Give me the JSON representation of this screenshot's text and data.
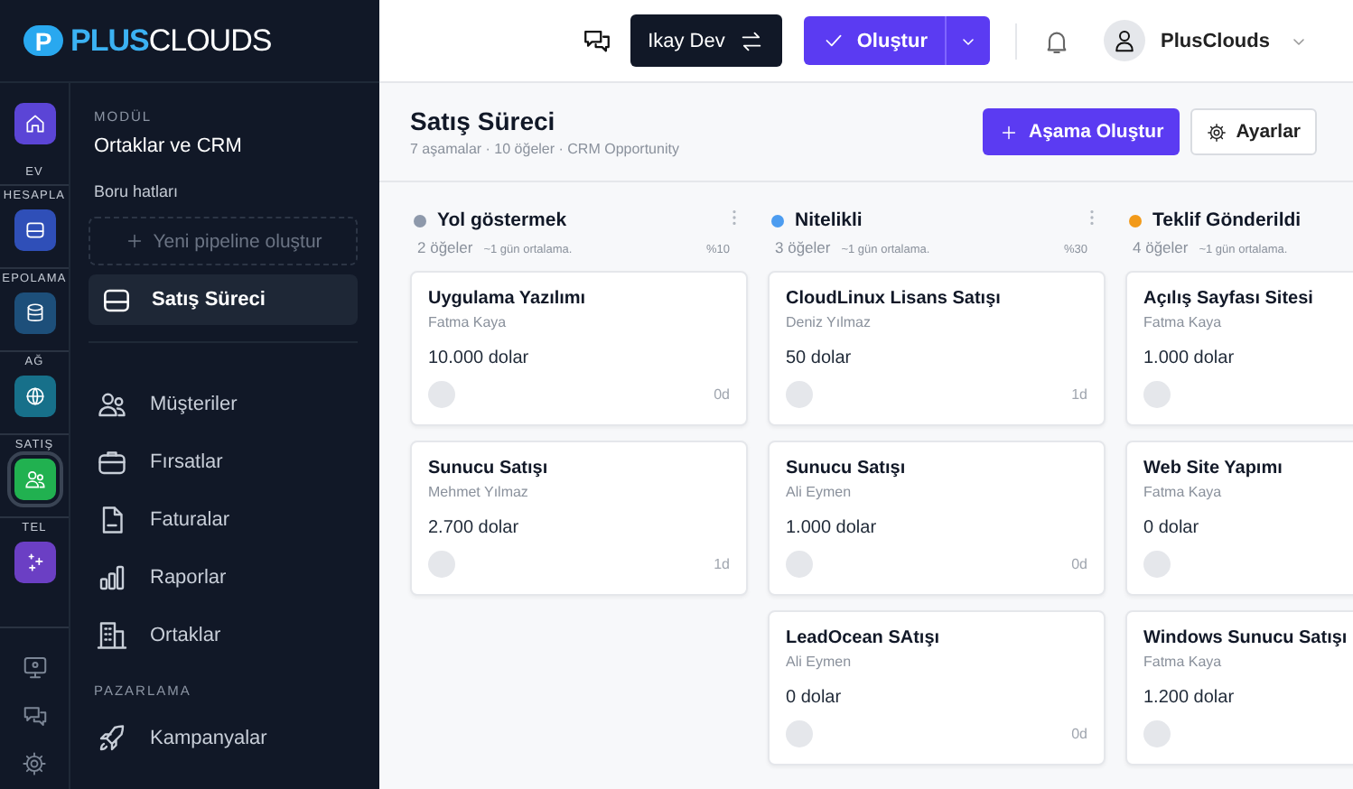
{
  "brand": {
    "logo_letter": "P",
    "name_bold": "PLUS",
    "name_light": "CLOUDS"
  },
  "rail": {
    "items": [
      {
        "label": "EV",
        "color": "#5b45d6",
        "kind": "home",
        "selected": false
      },
      {
        "label": "HESAPLA",
        "color": "#2f4fb8",
        "kind": "compute",
        "selected": false
      },
      {
        "label": "EPOLAMA",
        "color": "#1d4f7a",
        "kind": "storage",
        "selected": false
      },
      {
        "label": "AĞ",
        "color": "#17708a",
        "kind": "network",
        "selected": false
      },
      {
        "label": "SATIŞ",
        "color": "#21b150",
        "kind": "sales",
        "selected": true
      },
      {
        "label": "TEL",
        "color": "#6b3fc4",
        "kind": "telecom",
        "selected": false
      }
    ]
  },
  "panel": {
    "module_label": "MODÜL",
    "module_title": "Ortaklar ve CRM",
    "pipelines_label": "Boru hatları",
    "new_pipeline": "Yeni pipeline oluştur",
    "pipelines": [
      {
        "label": "Satış Süreci",
        "selected": true
      }
    ],
    "nav": [
      {
        "label": "Müşteriler",
        "kind": "customers"
      },
      {
        "label": "Fırsatlar",
        "kind": "opportunities"
      },
      {
        "label": "Faturalar",
        "kind": "invoices"
      },
      {
        "label": "Raporlar",
        "kind": "reports"
      },
      {
        "label": "Ortaklar",
        "kind": "partners"
      }
    ],
    "section_label": "PAZARLAMA",
    "section_nav": [
      {
        "label": "Kampanyalar",
        "kind": "campaigns"
      }
    ]
  },
  "topbar": {
    "workspace": "Ikay Dev",
    "create": "Oluştur",
    "user": "PlusClouds"
  },
  "page": {
    "title": "Satış Süreci",
    "subtitle": "7 aşamalar · 10 öğeler · CRM Opportunity",
    "add_stage": "Aşama Oluştur",
    "settings": "Ayarlar"
  },
  "stages": [
    {
      "name": "Yol göstermek",
      "color": "#8e99ab",
      "count": "2 öğeler",
      "average": "~1 gün ortalama.",
      "percent": "%10",
      "cards": [
        {
          "title": "Uygulama Yazılımı",
          "owner": "Fatma Kaya",
          "amount": "10.000 dolar",
          "age": "0d"
        },
        {
          "title": "Sunucu Satışı",
          "owner": "Mehmet Yılmaz",
          "amount": "2.700 dolar",
          "age": "1d"
        }
      ]
    },
    {
      "name": "Nitelikli",
      "color": "#4c9cf0",
      "count": "3 öğeler",
      "average": "~1 gün ortalama.",
      "percent": "%30",
      "cards": [
        {
          "title": "CloudLinux Lisans Satışı",
          "owner": "Deniz Yılmaz",
          "amount": "50 dolar",
          "age": "1d"
        },
        {
          "title": "Sunucu Satışı",
          "owner": "Ali Eymen",
          "amount": "1.000 dolar",
          "age": "0d"
        },
        {
          "title": "LeadOcean SAtışı",
          "owner": "Ali Eymen",
          "amount": "0 dolar",
          "age": "0d"
        }
      ]
    },
    {
      "name": "Teklif Gönderildi",
      "color": "#f29a1a",
      "count": "4 öğeler",
      "average": "~1 gün ortalama.",
      "cards": [
        {
          "title": "Açılış Sayfası Sitesi",
          "owner": "Fatma Kaya",
          "amount": "1.000 dolar"
        },
        {
          "title": "Web Site Yapımı",
          "owner": "Fatma Kaya",
          "amount": "0 dolar"
        },
        {
          "title": "Windows Sunucu Satışı",
          "owner": "Fatma Kaya",
          "amount": "1.200 dolar"
        }
      ]
    }
  ]
}
